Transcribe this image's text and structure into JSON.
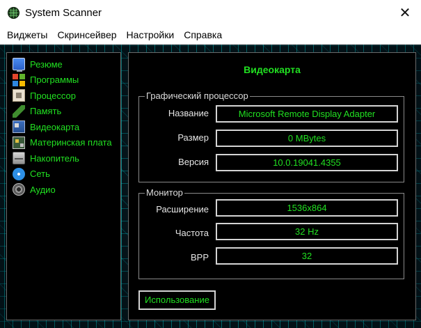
{
  "window": {
    "title": "System Scanner",
    "close_glyph": "✕"
  },
  "menu": [
    {
      "label": "Виджеты"
    },
    {
      "label": "Скринсейвер"
    },
    {
      "label": "Настройки"
    },
    {
      "label": "Справка"
    }
  ],
  "sidebar": {
    "items": [
      {
        "label": "Резюме",
        "icon": "monitor-icon"
      },
      {
        "label": "Программы",
        "icon": "windows-logo-icon"
      },
      {
        "label": "Процессор",
        "icon": "cpu-icon"
      },
      {
        "label": "Память",
        "icon": "ram-icon"
      },
      {
        "label": "Видеокарта",
        "icon": "video-card-icon"
      },
      {
        "label": "Материнская плата",
        "icon": "motherboard-icon"
      },
      {
        "label": "Накопитель",
        "icon": "storage-icon"
      },
      {
        "label": "Сеть",
        "icon": "network-icon"
      },
      {
        "label": "Аудио",
        "icon": "audio-icon"
      }
    ]
  },
  "main": {
    "title": "Видеокарта",
    "gpu_group": {
      "legend": "Графический процессор",
      "name_label": "Название",
      "name_value": "Microsoft Remote Display Adapter",
      "size_label": "Размер",
      "size_value": "0 MBytes",
      "version_label": "Версия",
      "version_value": "10.0.19041.4355"
    },
    "monitor_group": {
      "legend": "Монитор",
      "resolution_label": "Расширение",
      "resolution_value": "1536x864",
      "frequency_label": "Частота",
      "frequency_value": "32 Hz",
      "bpp_label": "BPP",
      "bpp_value": "32"
    },
    "usage_button": "Использование"
  },
  "colors": {
    "accent_green": "#21e021",
    "panel_bg": "#000000",
    "border_gray": "#d4d4d4",
    "background_cyan": "#00dcdc"
  }
}
